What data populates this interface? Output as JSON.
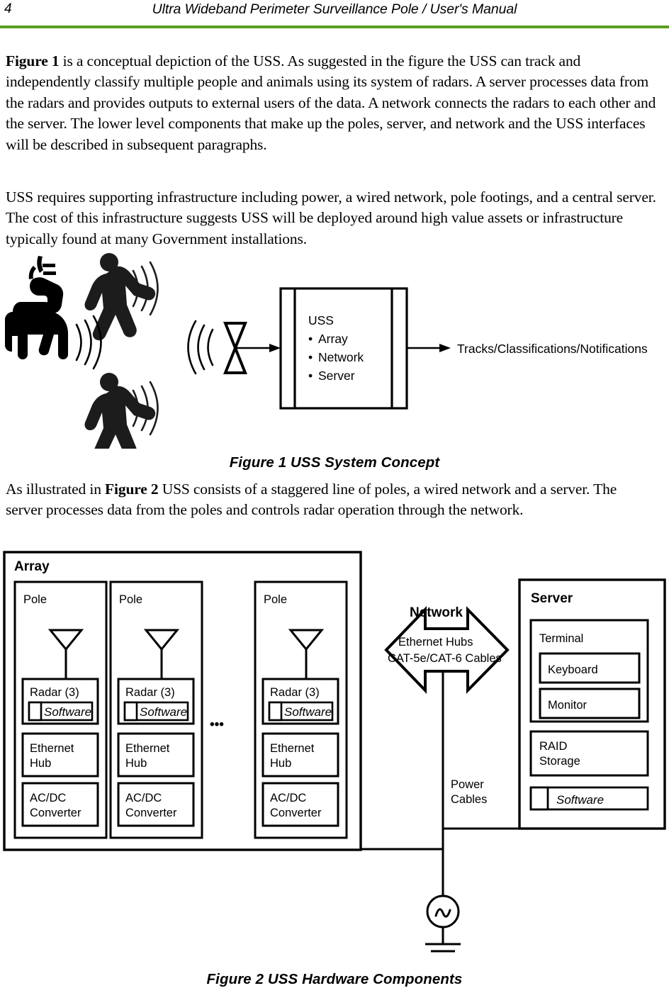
{
  "header": {
    "page_number": "4",
    "title": "Ultra Wideband Perimeter Surveillance Pole / User's Manual",
    "rule_color": "#5c9e24"
  },
  "body": {
    "paragraph_1_lead": "Figure 1",
    "paragraph_1_rest": " is a conceptual depiction of the USS. As suggested in the figure the USS can track and independently classify multiple people and animals using its system of radars. A server processes data from the radars and provides outputs to external users of the data. A network connects the radars to each other and the server. The lower level components that make up the poles, server, and network and the USS interfaces will be described in subsequent paragraphs.",
    "paragraph_2": "USS requires supporting infrastructure including power, a wired network, pole footings, and a central server.  The cost of this infrastructure suggests USS will be deployed around high value assets or infrastructure typically found at many Government installations.",
    "paragraph_3_pre": "As illustrated in ",
    "paragraph_3_lead": "Figure 2",
    "paragraph_3_rest": " USS consists of a staggered line of poles, a wired network and a server. The server processes data from the poles and controls radar operation through the network."
  },
  "figure1": {
    "caption": "Figure 1  USS System Concept",
    "uss_box": {
      "title": "USS",
      "bullets": [
        "Array",
        "Network",
        "Server"
      ]
    },
    "output_label": "Tracks/Classifications/Notifications",
    "targets": [
      {
        "name": "walking-person-upper",
        "icon": "walking-person-icon"
      },
      {
        "name": "deer",
        "icon": "deer-icon"
      },
      {
        "name": "walking-person-lower",
        "icon": "walking-person-icon"
      }
    ],
    "antenna_icon": "bowtie-antenna-icon"
  },
  "figure2": {
    "caption": "Figure 2  USS Hardware Components",
    "array": {
      "title": "Array",
      "ellipsis": "•••",
      "poles": [
        {
          "title": "Pole",
          "antenna_icon": "antenna-icon",
          "radar": {
            "label": "Radar (3)",
            "software": "Software"
          },
          "ethernet_hub": "Ethernet\nHub",
          "ethernet_hub_line1": "Ethernet",
          "ethernet_hub_line2": "Hub",
          "converter_line1": "AC/DC",
          "converter_line2": "Converter"
        },
        {
          "title": "Pole",
          "antenna_icon": "antenna-icon",
          "radar": {
            "label": "Radar (3)",
            "software": "Software"
          },
          "ethernet_hub_line1": "Ethernet",
          "ethernet_hub_line2": "Hub",
          "converter_line1": "AC/DC",
          "converter_line2": "Converter"
        },
        {
          "title": "Pole",
          "antenna_icon": "antenna-icon",
          "radar": {
            "label": "Radar (3)",
            "software": "Software"
          },
          "ethernet_hub_line1": "Ethernet",
          "ethernet_hub_line2": "Hub",
          "converter_line1": "AC/DC",
          "converter_line2": "Converter"
        }
      ]
    },
    "network": {
      "title": "Network",
      "line1": "Ethernet Hubs",
      "line2": "CAT-5e/CAT-6 Cables"
    },
    "server": {
      "title": "Server",
      "terminal": {
        "label": "Terminal",
        "keyboard": "Keyboard",
        "monitor": "Monitor"
      },
      "raid_line1": "RAID",
      "raid_line2": "Storage",
      "software": "Software"
    },
    "power": {
      "line1": "Power",
      "line2": "Cables",
      "source_icon": "ac-source-icon",
      "ground_icon": "ground-icon"
    }
  }
}
